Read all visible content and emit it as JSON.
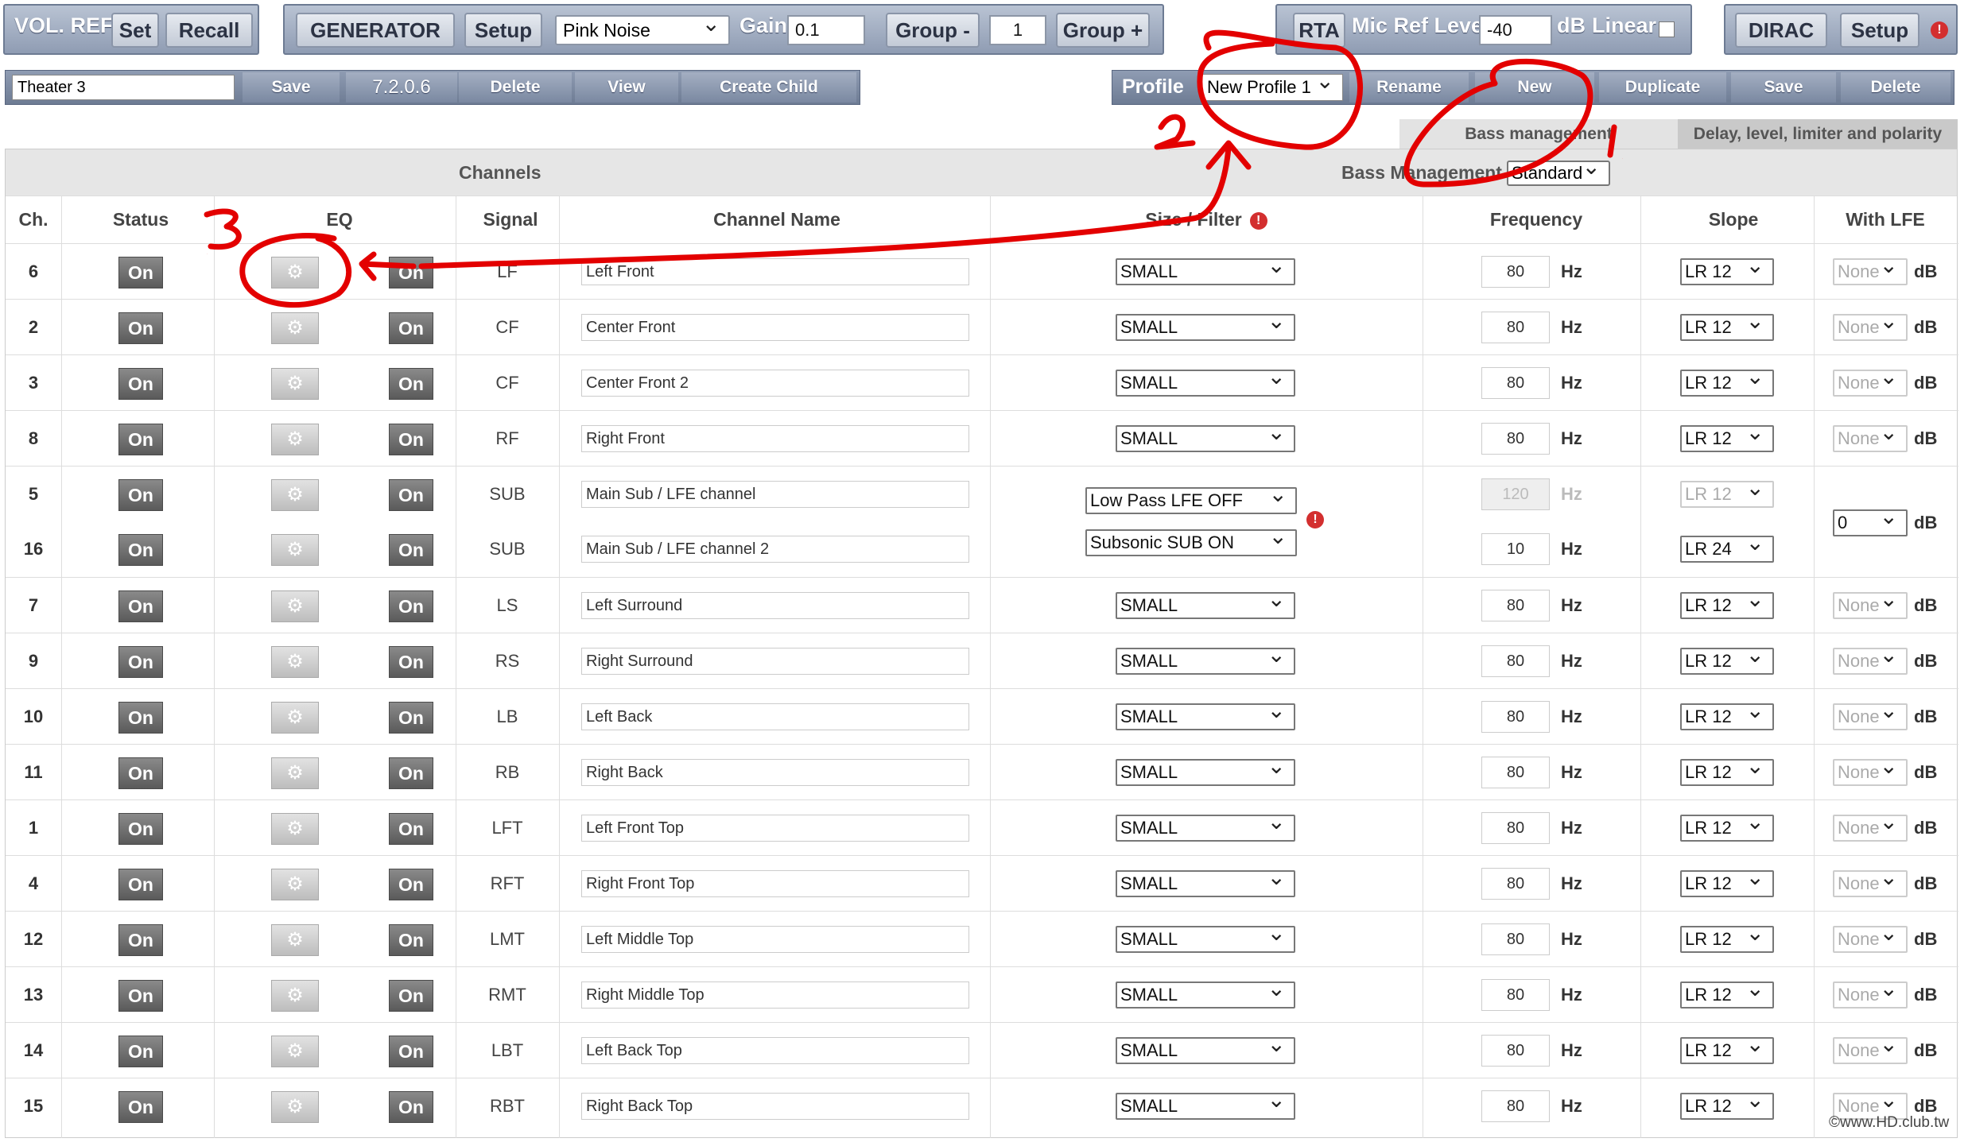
{
  "toolbar": {
    "vol_ref_label": "VOL. REF",
    "set_label": "Set",
    "recall_label": "Recall",
    "generator_label": "GENERATOR",
    "generator_setup_label": "Setup",
    "signal_select": "Pink Noise",
    "gain_label": "Gain",
    "gain_value": "0.1",
    "group_minus_label": "Group -",
    "group_value": "1",
    "group_plus_label": "Group +",
    "rta_label": "RTA",
    "mic_ref_label": "Mic Ref Level",
    "mic_ref_value": "-40",
    "db_label": "dB",
    "linear_label": "Linear",
    "dirac_label": "DIRAC",
    "dirac_setup_label": "Setup",
    "alert_symbol": "!"
  },
  "toolbar2": {
    "preset_name": "Theater 3",
    "save_label": "Save",
    "version": "7.2.0.6",
    "delete_label": "Delete",
    "view_label": "View",
    "create_child_label": "Create Child",
    "profile_label": "Profile",
    "profile_select": "New Profile 1",
    "rename_label": "Rename",
    "new_label": "New",
    "duplicate_label": "Duplicate",
    "save2_label": "Save",
    "delete2_label": "Delete"
  },
  "tabs": {
    "bass_management": "Bass management",
    "delay_level": "Delay, level, limiter and polarity"
  },
  "table": {
    "channels_title": "Channels",
    "bass_management_label": "Bass Management",
    "bass_management_value": "Standard",
    "headers": {
      "ch": "Ch.",
      "status": "Status",
      "eq": "EQ",
      "signal": "Signal",
      "channel_name": "Channel Name",
      "size_filter": "Size / Filter",
      "frequency": "Frequency",
      "slope": "Slope",
      "with_lfe": "With LFE"
    },
    "on_label": "On",
    "hz_label": "Hz",
    "db_label": "dB",
    "rows": [
      {
        "ch": "6",
        "signal": "LF",
        "name": "Left Front",
        "size": "SMALL",
        "freq": "80",
        "slope": "LR 12",
        "lfe": "None"
      },
      {
        "ch": "2",
        "signal": "CF",
        "name": "Center Front",
        "size": "SMALL",
        "freq": "80",
        "slope": "LR 12",
        "lfe": "None"
      },
      {
        "ch": "3",
        "signal": "CF",
        "name": "Center Front 2",
        "size": "SMALL",
        "freq": "80",
        "slope": "LR 12",
        "lfe": "None"
      },
      {
        "ch": "8",
        "signal": "RF",
        "name": "Right Front",
        "size": "SMALL",
        "freq": "80",
        "slope": "LR 12",
        "lfe": "None"
      },
      {
        "ch": "5",
        "signal": "SUB",
        "name": "Main Sub / LFE channel",
        "size": "Low Pass LFE OFF",
        "freq": "120",
        "slope": "LR 12",
        "lfe": "0"
      },
      {
        "ch": "16",
        "signal": "SUB",
        "name": "Main Sub / LFE channel 2",
        "size": "Subsonic SUB ON",
        "freq": "10",
        "slope": "LR 24",
        "lfe": ""
      },
      {
        "ch": "7",
        "signal": "LS",
        "name": "Left Surround",
        "size": "SMALL",
        "freq": "80",
        "slope": "LR 12",
        "lfe": "None"
      },
      {
        "ch": "9",
        "signal": "RS",
        "name": "Right Surround",
        "size": "SMALL",
        "freq": "80",
        "slope": "LR 12",
        "lfe": "None"
      },
      {
        "ch": "10",
        "signal": "LB",
        "name": "Left Back",
        "size": "SMALL",
        "freq": "80",
        "slope": "LR 12",
        "lfe": "None"
      },
      {
        "ch": "11",
        "signal": "RB",
        "name": "Right Back",
        "size": "SMALL",
        "freq": "80",
        "slope": "LR 12",
        "lfe": "None"
      },
      {
        "ch": "1",
        "signal": "LFT",
        "name": "Left Front Top",
        "size": "SMALL",
        "freq": "80",
        "slope": "LR 12",
        "lfe": "None"
      },
      {
        "ch": "4",
        "signal": "RFT",
        "name": "Right Front Top",
        "size": "SMALL",
        "freq": "80",
        "slope": "LR 12",
        "lfe": "None"
      },
      {
        "ch": "12",
        "signal": "LMT",
        "name": "Left Middle Top",
        "size": "SMALL",
        "freq": "80",
        "slope": "LR 12",
        "lfe": "None"
      },
      {
        "ch": "13",
        "signal": "RMT",
        "name": "Right Middle Top",
        "size": "SMALL",
        "freq": "80",
        "slope": "LR 12",
        "lfe": "None"
      },
      {
        "ch": "14",
        "signal": "LBT",
        "name": "Left Back Top",
        "size": "SMALL",
        "freq": "80",
        "slope": "LR 12",
        "lfe": "None"
      },
      {
        "ch": "15",
        "signal": "RBT",
        "name": "Right Back Top",
        "size": "SMALL",
        "freq": "80",
        "slope": "LR 12",
        "lfe": "None"
      }
    ]
  },
  "annotations": {
    "mark_1": "1",
    "mark_2": "2",
    "mark_3": "3",
    "color": "#e30000"
  },
  "watermark": "©www.HD.club.tw"
}
